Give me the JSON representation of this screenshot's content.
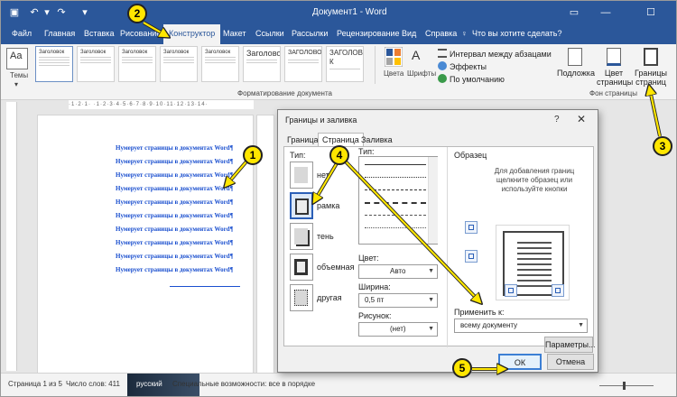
{
  "titlebar": {
    "title": "Документ1 - Word",
    "min": "—",
    "max": "☐",
    "close": "✕"
  },
  "tabs": [
    "Файл",
    "Главная",
    "Вставка",
    "Рисование",
    "Конструктор",
    "Макет",
    "Ссылки",
    "Рассылки",
    "Рецензирование",
    "Вид",
    "Справка"
  ],
  "active_tab": "Конструктор",
  "tell_me": "Что вы хотите сделать?",
  "ribbon": {
    "themes_label": "Темы",
    "styles": [
      {
        "heading": "Заголовок",
        "big": ""
      },
      {
        "heading": "Заголовок",
        "big": ""
      },
      {
        "heading": "Заголовок",
        "big": ""
      },
      {
        "heading": "Заголовок",
        "big": ""
      },
      {
        "heading": "Заголовок",
        "big": ""
      },
      {
        "heading": "",
        "big": "Заголово"
      },
      {
        "heading": "",
        "big": "ЗАГОЛОВОК"
      },
      {
        "heading": "",
        "big": "ЗАГОЛОВО К"
      }
    ],
    "colors_label": "Цвета",
    "fonts_label": "Шрифты",
    "paragraph_spacing": "Интервал между абзацами",
    "effects": "Эффекты",
    "set_default": "По умолчанию",
    "group_format": "Форматирование документа",
    "watermark": "Подложка",
    "page_color": "Цвет страницы",
    "page_borders": "Границы страниц",
    "group_bg": "Фон страницы"
  },
  "document": {
    "lines": [
      "Нумерует страницы в документах Word¶",
      "Нумерует страницы в документах Word¶",
      "Нумерует страницы в документах Word¶",
      "Нумерует страницы в документах Word¶",
      "Нумерует страницы в документах Word¶",
      "Нумерует страницы в документах Word¶",
      "Нумерует страницы в документах Word¶",
      "Нумерует страницы в документах Word¶",
      "Нумерует страницы в документах Word¶",
      "Нумерует страницы в документах Word¶"
    ],
    "ruler": "·1·2·1·  ·1·2·3·4·5·6·7·8·9·10·11·12·13·14·"
  },
  "dialog": {
    "title": "Границы и заливка",
    "help": "?",
    "close": "✕",
    "tabs": [
      "Граница",
      "Страница",
      "Заливка"
    ],
    "active_tab": "Страница",
    "type_label": "Тип:",
    "types": [
      "нет",
      "рамка",
      "тень",
      "объемная",
      "другая"
    ],
    "selected_type": "рамка",
    "style_label": "Тип:",
    "color_label": "Цвет:",
    "color_value": "Авто",
    "width_label": "Ширина:",
    "width_value": "0,5 пт",
    "art_label": "Рисунок:",
    "art_value": "(нет)",
    "preview_label": "Образец",
    "preview_hint": "Для добавления границ щелкните образец или используйте кнопки",
    "apply_label": "Применить к:",
    "apply_value": "всему документу",
    "options_button": "Параметры...",
    "ok_button": "ОК",
    "cancel_button": "Отмена"
  },
  "status": {
    "page": "Страница 1 из 5",
    "words": "Число слов: 411",
    "lang": "русский",
    "accessibility": "Специальные возможности: все в порядке"
  },
  "annotations": [
    "1",
    "2",
    "3",
    "4",
    "5"
  ],
  "colors": {
    "accent": "#2b579a",
    "badge": "#ffe600",
    "doc_text": "#1a4fcf"
  }
}
